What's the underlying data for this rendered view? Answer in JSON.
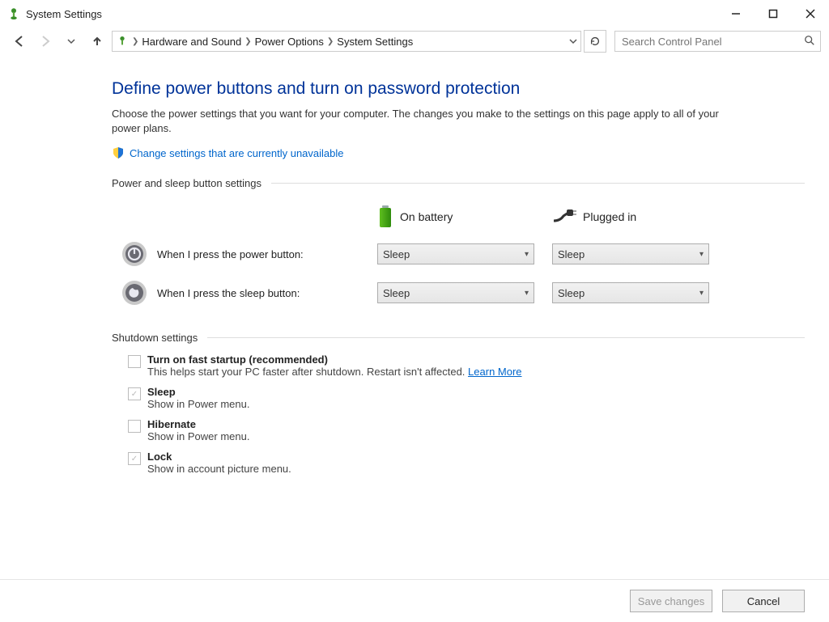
{
  "window": {
    "title": "System Settings"
  },
  "breadcrumb": {
    "items": [
      "Hardware and Sound",
      "Power Options",
      "System Settings"
    ]
  },
  "search": {
    "placeholder": "Search Control Panel"
  },
  "page": {
    "title": "Define power buttons and turn on password protection",
    "description": "Choose the power settings that you want for your computer. The changes you make to the settings on this page apply to all of your power plans.",
    "change_link": "Change settings that are currently unavailable"
  },
  "sections": {
    "power_sleep_label": "Power and sleep button settings",
    "shutdown_label": "Shutdown settings"
  },
  "columns": {
    "battery_label": "On battery",
    "plugged_label": "Plugged in"
  },
  "rows": {
    "power_button_label": "When I press the power button:",
    "sleep_button_label": "When I press the sleep button:",
    "power_button_battery": "Sleep",
    "power_button_plugged": "Sleep",
    "sleep_button_battery": "Sleep",
    "sleep_button_plugged": "Sleep"
  },
  "shutdown": {
    "fast_startup_title": "Turn on fast startup (recommended)",
    "fast_startup_sub": "This helps start your PC faster after shutdown. Restart isn't affected.",
    "learn_more": "Learn More",
    "sleep_title": "Sleep",
    "sleep_sub": "Show in Power menu.",
    "hibernate_title": "Hibernate",
    "hibernate_sub": "Show in Power menu.",
    "lock_title": "Lock",
    "lock_sub": "Show in account picture menu."
  },
  "footer": {
    "save_label": "Save changes",
    "cancel_label": "Cancel"
  }
}
